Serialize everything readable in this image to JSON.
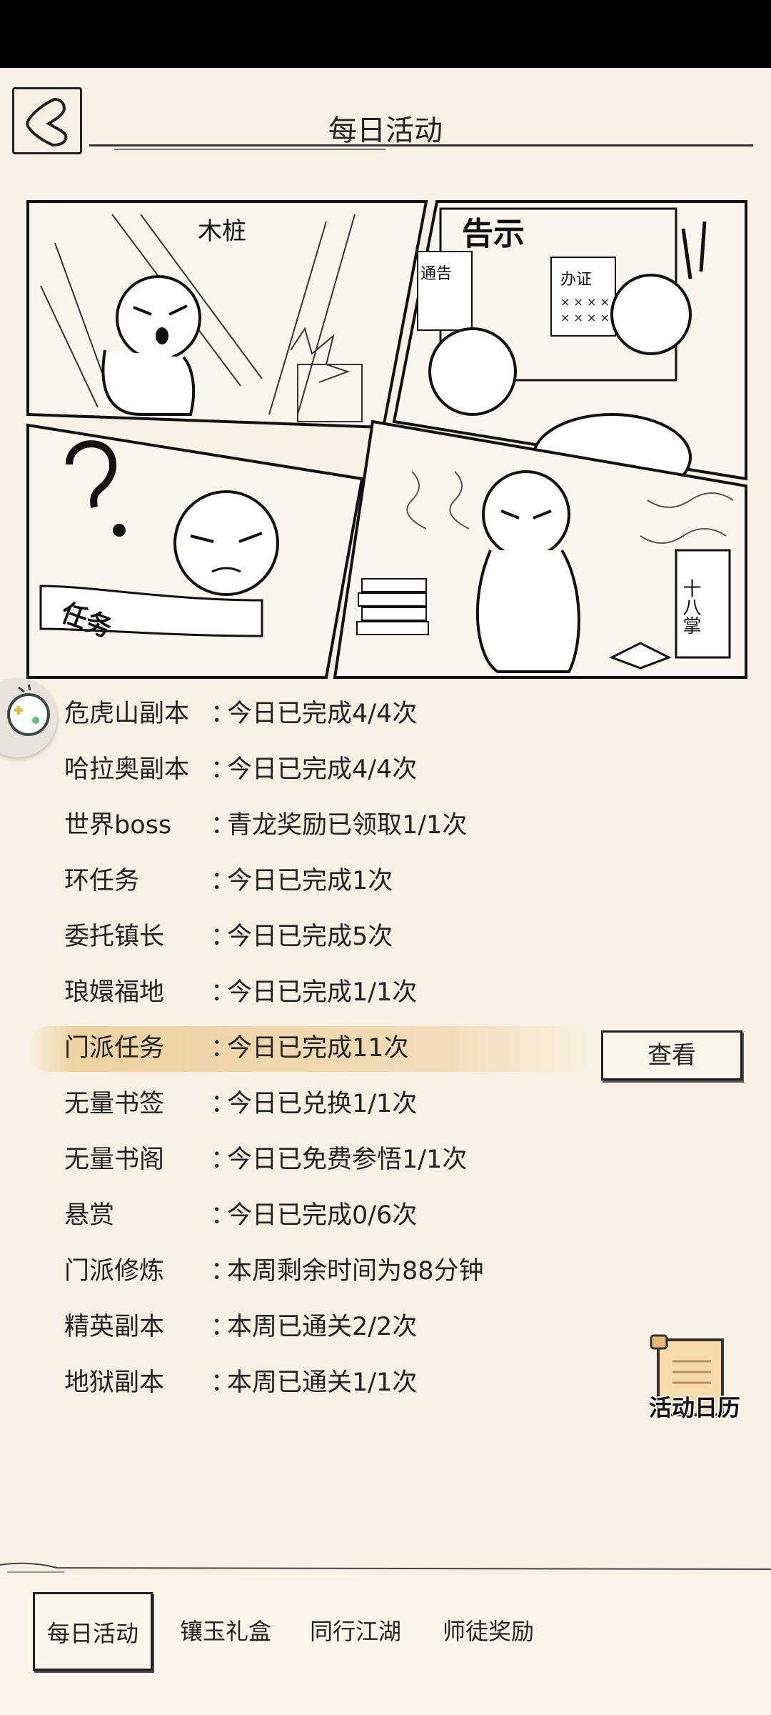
{
  "header": {
    "title": "每日活动"
  },
  "comic": {
    "panel1_text": "木桩",
    "panel2_title": "告示",
    "panel2_notice_left": "通告",
    "panel2_notice_right": "办证",
    "panel3_scroll": "任务",
    "panel4_book": "十八掌"
  },
  "activities": [
    {
      "name": "危虎山副本",
      "status": "今日已完成4/4次"
    },
    {
      "name": "哈拉奥副本",
      "status": "今日已完成4/4次"
    },
    {
      "name": "世界boss",
      "status": "青龙奖励已领取1/1次"
    },
    {
      "name": "环任务",
      "status": "今日已完成1次"
    },
    {
      "name": "委托镇长",
      "status": "今日已完成5次"
    },
    {
      "name": "琅嬛福地",
      "status": "今日已完成1/1次"
    },
    {
      "name": "门派任务",
      "status": "今日已完成11次"
    },
    {
      "name": "无量书签",
      "status": "今日已兑换1/1次"
    },
    {
      "name": "无量书阁",
      "status": "今日已免费参悟1/1次"
    },
    {
      "name": "悬赏",
      "status": "今日已完成0/6次"
    },
    {
      "name": "门派修炼",
      "status": "本周剩余时间为88分钟"
    },
    {
      "name": "精英副本",
      "status": "本周已通关2/2次"
    },
    {
      "name": "地狱副本",
      "status": "本周已通关1/1次"
    }
  ],
  "colon": "：",
  "view_button": "查看",
  "calendar_label": "活动日历",
  "tabs": [
    "每日活动",
    "镶玉礼盒",
    "同行江湖",
    "师徒奖励"
  ]
}
